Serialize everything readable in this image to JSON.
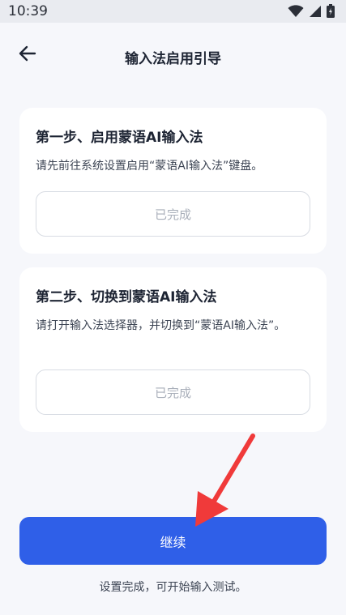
{
  "status_bar": {
    "time": "10:39",
    "icons": [
      "wifi-icon",
      "signal-icon",
      "battery-icon"
    ]
  },
  "header": {
    "title": "输入法启用引导",
    "back_icon": "arrow-left-icon"
  },
  "steps": [
    {
      "title": "第一步、启用蒙语AI输入法",
      "description": "请先前往系统设置启用“蒙语AI输入法”键盘。",
      "button_label": "已完成"
    },
    {
      "title": "第二步、切换到蒙语AI输入法",
      "description": "请打开输入法选择器，并切换到“蒙语AI输入法”。",
      "button_label": "已完成"
    }
  ],
  "continue_button": {
    "label": "继续"
  },
  "footer": {
    "hint": "设置完成，可开始输入测试。"
  },
  "colors": {
    "primary": "#2f5fe8",
    "background": "#f6f7fb",
    "card": "#ffffff",
    "disabled_text": "#a9afba",
    "annotation_arrow": "#f03a3a"
  }
}
